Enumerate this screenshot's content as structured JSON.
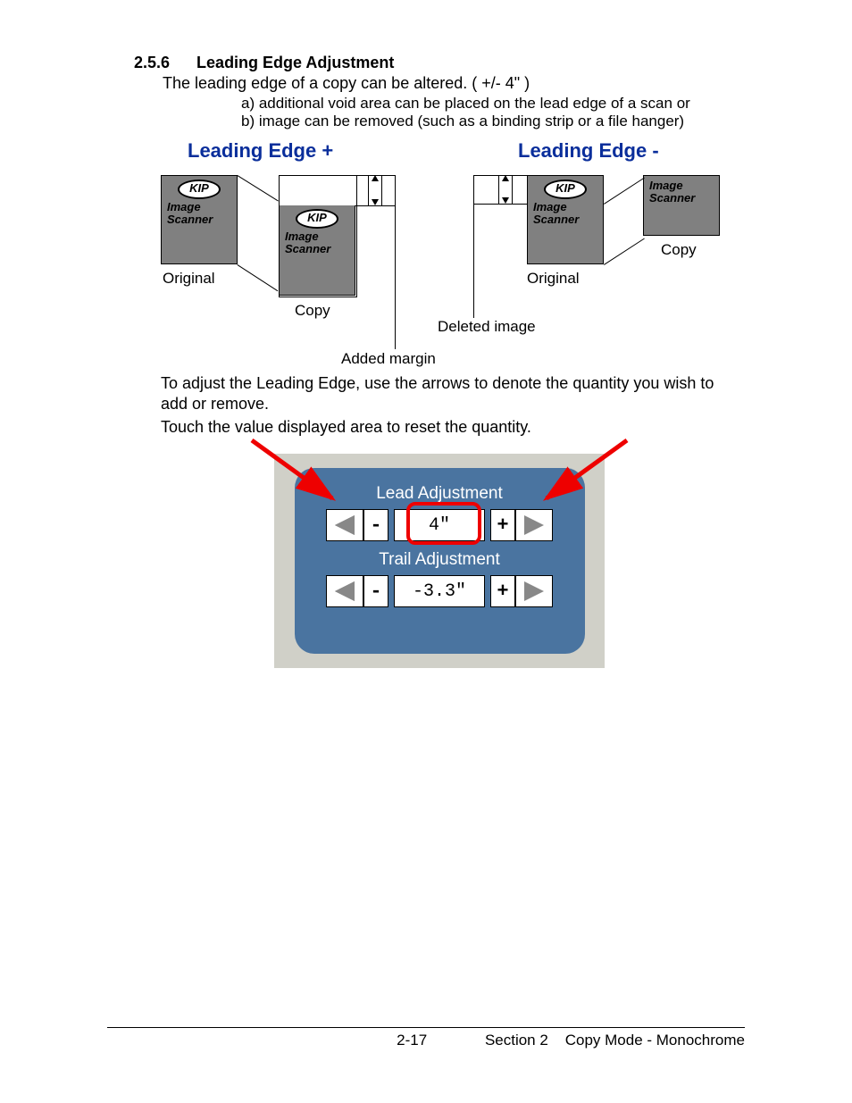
{
  "heading": {
    "num": "2.5.6",
    "title": "Leading Edge Adjustment"
  },
  "intro": "The leading edge of a copy can be altered. ( +/- 4\" )",
  "sub_a": "a) additional void area can be placed on the lead edge of a scan or",
  "sub_b": "b) image can be removed (such as a binding strip or a file hanger)",
  "diagram": {
    "plus_title": "Leading Edge +",
    "minus_title": "Leading Edge -",
    "original_label": "Original",
    "copy_label": "Copy",
    "added_margin_label": "Added margin",
    "deleted_image_label": "Deleted image",
    "kip_logo": "KIP",
    "kip_line1": "Image",
    "kip_line2": "Scanner"
  },
  "body1": "To adjust the Leading Edge, use the arrows to denote the quantity you wish to add or remove.",
  "body2": "Touch the value displayed area to reset the quantity.",
  "panel": {
    "lead_label": "Lead Adjustment",
    "lead_value": "4\"",
    "trail_label": "Trail Adjustment",
    "trail_value": "-3.3\"",
    "minus": "-",
    "plus": "+"
  },
  "footer": {
    "page_num": "2-17",
    "section": "Section 2",
    "title": "Copy Mode - Monochrome"
  }
}
